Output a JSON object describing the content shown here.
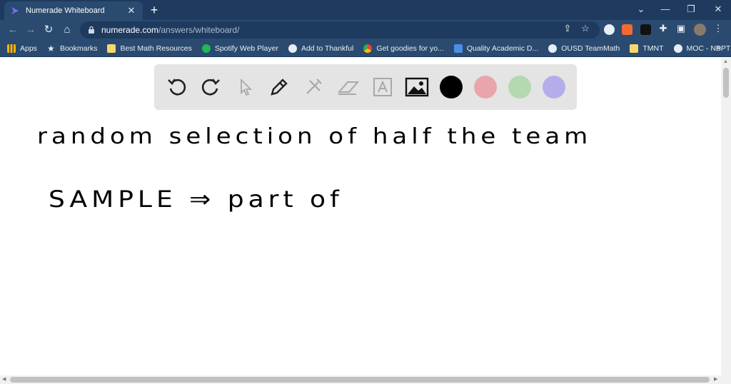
{
  "browser": {
    "tab_title": "Numerade Whiteboard",
    "url_host": "numerade.com",
    "url_path": "/answers/whiteboard/"
  },
  "bookmarks": [
    {
      "label": "Apps",
      "icon": "apps-grid-icon",
      "color": "#ffb300"
    },
    {
      "label": "Bookmarks",
      "icon": "star-icon",
      "color": "#e8eef5"
    },
    {
      "label": "Best Math Resources",
      "icon": "folder-icon",
      "color": "#f5d76e"
    },
    {
      "label": "Spotify Web Player",
      "icon": "spotify-icon",
      "color": "#1db954"
    },
    {
      "label": "Add to Thankful",
      "icon": "thankful-icon",
      "color": "#e8eef5"
    },
    {
      "label": "Get goodies for yo...",
      "icon": "chrome-icon",
      "color": "#e94235"
    },
    {
      "label": "Quality Academic D...",
      "icon": "doc-icon",
      "color": "#4a90e2"
    },
    {
      "label": "OUSD TeamMath",
      "icon": "ousd-icon",
      "color": "#e8eef5"
    },
    {
      "label": "TMNT",
      "icon": "folder-icon",
      "color": "#f5d76e"
    },
    {
      "label": "MOC - NBPTS",
      "icon": "wordpress-icon",
      "color": "#e8eef5"
    }
  ],
  "whiteboard": {
    "colors": [
      "#000000",
      "#e8a6ac",
      "#b4d8b0",
      "#b3aeea"
    ],
    "lines": [
      "random  selection  of  half  the  team",
      "SAMPLE ⇒ part  of"
    ]
  }
}
